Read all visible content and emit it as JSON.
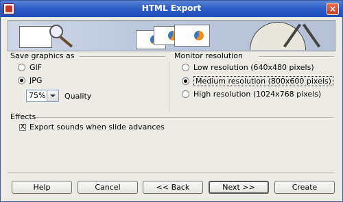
{
  "window": {
    "title": "HTML Export",
    "close_glyph": "×"
  },
  "left_group": {
    "title": "Save graphics as",
    "options": [
      "GIF",
      "JPG"
    ],
    "selected": "JPG",
    "quality_value": "75%",
    "quality_label": "Quality"
  },
  "right_group": {
    "title": "Monitor resolution",
    "options": [
      "Low resolution (640x480 pixels)",
      "Medium resolution (800x600 pixels)",
      "High resolution (1024x768 pixels)"
    ],
    "selected": "Medium resolution (800x600 pixels)"
  },
  "effects": {
    "title": "Effects",
    "checkbox_label": "Export sounds when slide advances",
    "checked": true,
    "check_glyph": "X"
  },
  "buttons": {
    "help": "Help",
    "cancel": "Cancel",
    "back": "<< Back",
    "next": "Next >>",
    "create": "Create"
  },
  "colors": {
    "titlebar": "#2f5fc7",
    "dialog_bg": "#ecebe6"
  },
  "icons": [
    "app-icon",
    "close-icon",
    "banner-illustration"
  ]
}
